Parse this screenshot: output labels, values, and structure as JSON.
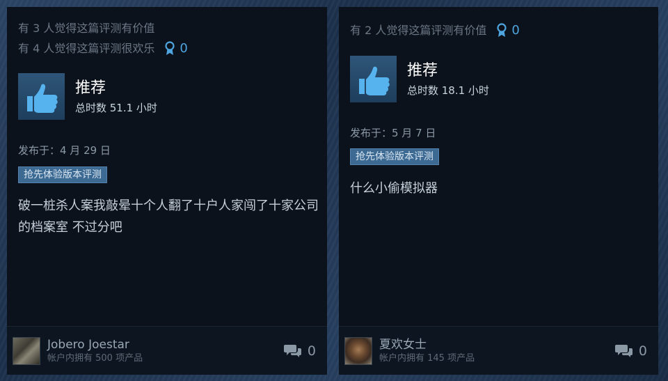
{
  "reviews": [
    {
      "helpful_text": "有 3 人觉得这篇评测有价值",
      "funny_text": "有 4 人觉得这篇评测很欢乐",
      "award_count": "0",
      "recommendation": "推荐",
      "playtime": "总时数 51.1 小时",
      "posted": "发布于：4 月 29 日",
      "badge": "抢先体验版本评测",
      "text": "破一桩杀人案我敲晕十个人翻了十户人家闯了十家公司的档案室 不过分吧",
      "author": "Jobero Joestar",
      "products": "帐户内拥有 500 项产品",
      "comment_count": "0"
    },
    {
      "helpful_text": "有 2 人觉得这篇评测有价值",
      "award_count": "0",
      "recommendation": "推荐",
      "playtime": "总时数 18.1 小时",
      "posted": "发布于：5 月 7 日",
      "badge": "抢先体验版本评测",
      "text": "什么小偷模拟器",
      "author": "夏欢女士",
      "products": "帐户内拥有 145 项产品",
      "comment_count": "0"
    }
  ],
  "colors": {
    "accent_blue": "#4fa5e0",
    "card_bg": "#0b121b",
    "badge_bg": "#3d6a93"
  },
  "icons": {
    "award": "award-ribbon-icon",
    "thumb": "thumbs-up-icon",
    "comment": "comment-bubbles-icon"
  }
}
